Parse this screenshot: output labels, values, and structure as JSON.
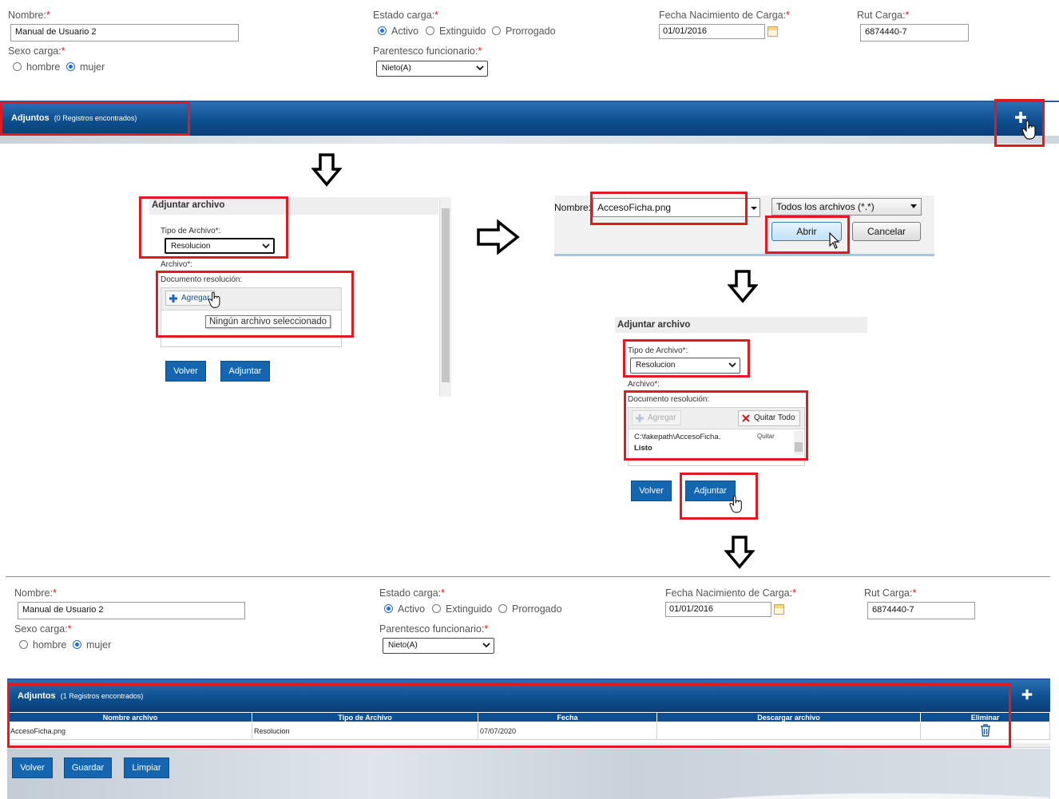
{
  "form": {
    "nombre_label": "Nombre:",
    "nombre_value": "Manual de Usuario 2",
    "estado_label": "Estado carga:",
    "estado_options": [
      "Activo",
      "Extinguido",
      "Prorrogado"
    ],
    "fecha_label": "Fecha Nacimiento de Carga:",
    "fecha_value": "01/01/2016",
    "rut_label": "Rut Carga:",
    "rut_value": "6874440-7",
    "sexo_label": "Sexo carga:",
    "sexo_options": [
      "hombre",
      "mujer"
    ],
    "parentesco_label": "Parentesco funcionario:",
    "parentesco_value": "Nieto(A)",
    "required_mark": "*"
  },
  "adjuntos_top": {
    "title": "Adjuntos",
    "count": "(0 Registros encontrados)"
  },
  "adjuntar_panel": {
    "title": "Adjuntar archivo",
    "tipo_label": "Tipo de Archivo*:",
    "tipo_value": "Resolucion",
    "archivo_label": "Archivo*:",
    "documento_label": "Documento resolución:",
    "agregar_label": "Agregar",
    "tooltip": "Ningún archivo seleccionado",
    "volver": "Volver",
    "adjuntar": "Adjuntar"
  },
  "file_dialog": {
    "nombre_label": "Nombre:",
    "file_name": "AccesoFicha.png",
    "filter": "Todos los archivos (*.*)",
    "abrir": "Abrir",
    "cancelar": "Cancelar"
  },
  "adjuntar_panel2": {
    "title": "Adjuntar archivo",
    "tipo_label": "Tipo de Archivo*:",
    "tipo_value": "Resolucion",
    "archivo_label": "Archivo*:",
    "documento_label": "Documento resolución:",
    "agregar_label": "Agregar",
    "quitar_todo": "Quitar Todo",
    "file_path": "C:\\fakepath\\AccesoFicha.",
    "quitar": "Quitar",
    "status": "Listo",
    "volver": "Volver",
    "adjuntar": "Adjuntar"
  },
  "adjuntos_bottom": {
    "title": "Adjuntos",
    "count": "(1 Registros encontrados)",
    "columns": [
      "Nombre archivo",
      "Tipo de Archivo",
      "Fecha",
      "Descargar archivo",
      "Eliminar"
    ],
    "rows": [
      {
        "nombre": "AccesoFicha.png",
        "tipo": "Resolucion",
        "fecha": "07/07/2020",
        "descargar": ""
      }
    ]
  },
  "bottom_buttons": [
    "Volver",
    "Guardar",
    "Limpiar"
  ],
  "icons": [
    "plus-icon",
    "hand-cursor-icon",
    "down-arrow-icon",
    "right-arrow-icon",
    "calendar-icon",
    "trash-icon",
    "close-icon",
    "chevron-down-icon"
  ],
  "colors": {
    "accent_blue": "#0e4f8f",
    "button_blue": "#1466b0",
    "highlight_red": "#e3191f"
  }
}
